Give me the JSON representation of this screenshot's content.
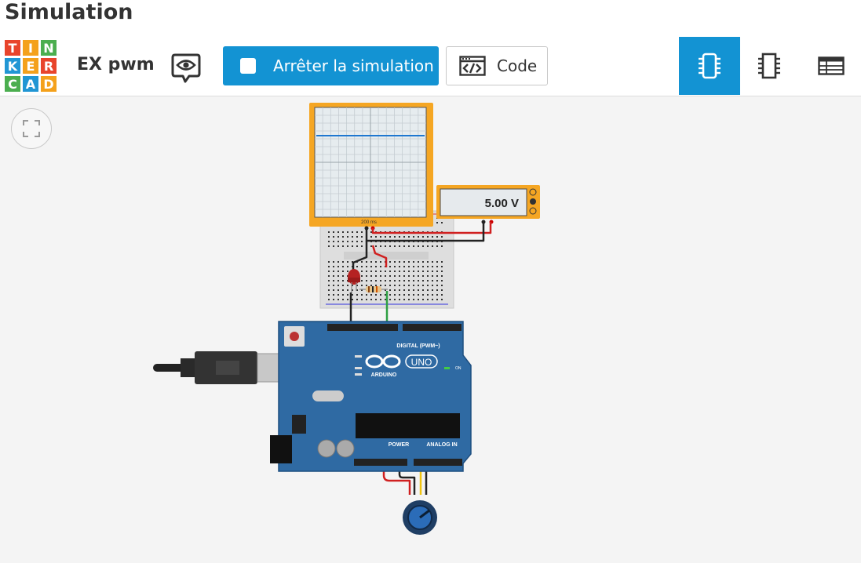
{
  "page": {
    "title": "Simulation"
  },
  "logo": {
    "letters": [
      "T",
      "I",
      "N",
      "K",
      "E",
      "R",
      "C",
      "A",
      "D"
    ]
  },
  "project": {
    "name": "EX pwm"
  },
  "toolbar": {
    "simulation_label": "Arrêter la simulation",
    "code_label": "Code"
  },
  "multimeter": {
    "reading": "5.00 V"
  },
  "oscilloscope": {
    "time_label": "200 ms"
  },
  "arduino": {
    "brand": "ARDUINO",
    "model": "UNO",
    "digital_label": "DIGITAL (PWM~)",
    "power_label": "POWER",
    "analog_label": "ANALOG IN",
    "on_label": "ON"
  },
  "colors": {
    "accent": "#1393d3",
    "board": "#2f6aa3",
    "breadboard": "#dedede",
    "scope_frame": "#f5a623"
  }
}
